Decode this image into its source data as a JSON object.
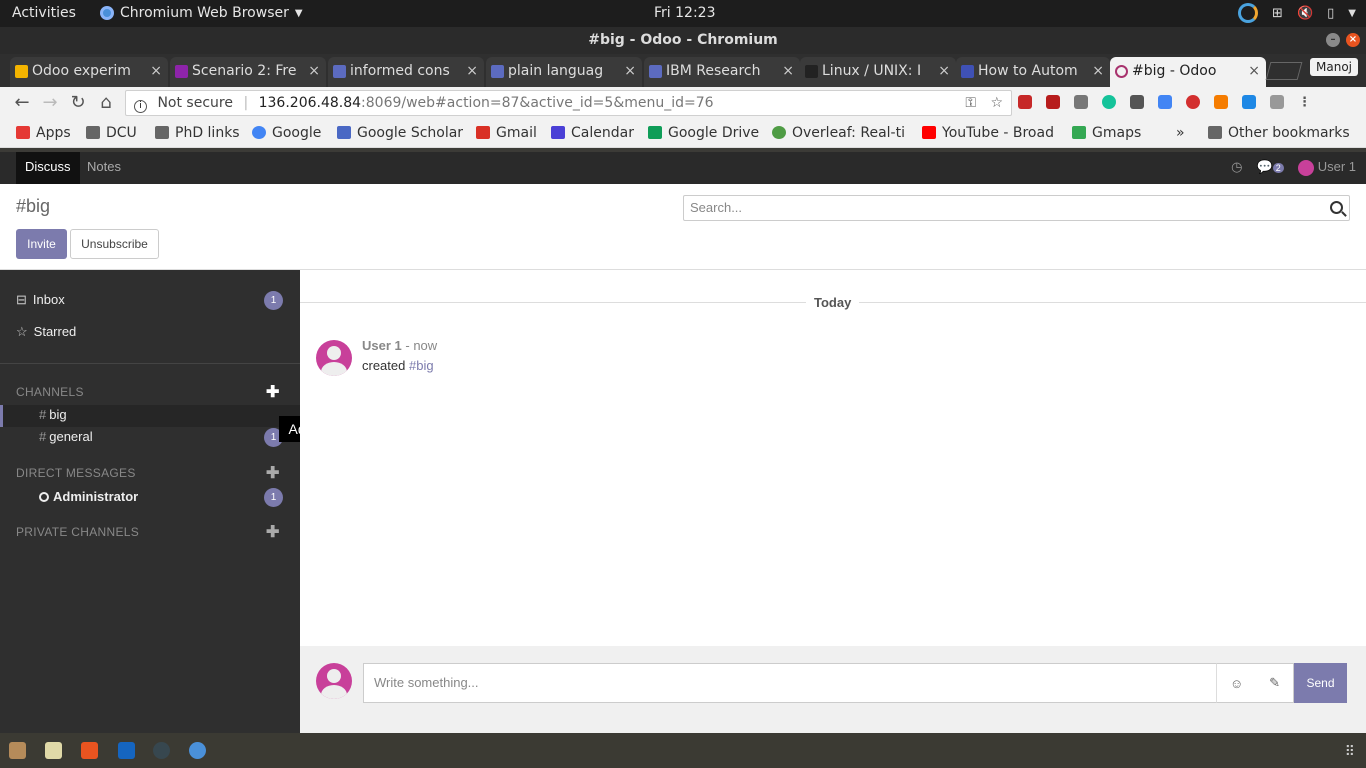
{
  "os": {
    "activities": "Activities",
    "app_name": "Chromium Web Browser",
    "clock": "Fri 12:23"
  },
  "window": {
    "title": "#big - Odoo - Chromium"
  },
  "tabs": [
    {
      "label": "Odoo experim",
      "color": "#f4b400"
    },
    {
      "label": "Scenario 2: Fre",
      "color": "#8e24aa"
    },
    {
      "label": "informed cons",
      "color": "#5c6bc0"
    },
    {
      "label": "plain languag",
      "color": "#5c6bc0"
    },
    {
      "label": "IBM Research",
      "color": "#5c6bc0"
    },
    {
      "label": "Linux / UNIX: I",
      "color": "#222222"
    },
    {
      "label": "How to Autom",
      "color": "#3f51b5"
    },
    {
      "label": "#big - Odoo",
      "color": "#a8336e"
    }
  ],
  "profile": "Manoj",
  "address": {
    "security": "Not secure",
    "host": "136.206.48.84",
    "path": ":8069/web#action=87&active_id=5&menu_id=76"
  },
  "bookmarks": [
    {
      "label": "Apps",
      "color": "#e53935"
    },
    {
      "label": "DCU",
      "color": "#666666"
    },
    {
      "label": "PhD links",
      "color": "#666666"
    },
    {
      "label": "Google",
      "color": "#4285f4"
    },
    {
      "label": "Google Scholar",
      "color": "#4a68c4"
    },
    {
      "label": "Gmail",
      "color": "#d93025"
    },
    {
      "label": "Calendar",
      "color": "#4a3fd6"
    },
    {
      "label": "Google Drive",
      "color": "#0f9d58"
    },
    {
      "label": "Overleaf: Real-ti",
      "color": "#4f9c45"
    },
    {
      "label": "YouTube - Broad",
      "color": "#ff0000"
    },
    {
      "label": "Gmaps",
      "color": "#34a853"
    }
  ],
  "bookmarks_more": "»",
  "other_bookmarks": "Other bookmarks",
  "odoo_nav": {
    "discuss": "Discuss",
    "notes": "Notes",
    "messages_count": "2",
    "user": "User 1"
  },
  "control": {
    "title": "#big",
    "invite": "Invite",
    "unsubscribe": "Unsubscribe",
    "search_placeholder": "Search..."
  },
  "sidebar": {
    "inbox": "Inbox",
    "inbox_count": "1",
    "starred": "Starred",
    "channels_header": "CHANNELS",
    "channels": [
      {
        "name": "big",
        "count": ""
      },
      {
        "name": "general",
        "count": "1"
      }
    ],
    "dm_header": "DIRECT MESSAGES",
    "dm_user": "Administrator",
    "dm_count": "1",
    "private_header": "PRIVATE CHANNELS"
  },
  "tooltip": "Add",
  "thread": {
    "separator": "Today",
    "author": "User 1",
    "time": "- now",
    "body_prefix": "created",
    "body_link": "#big"
  },
  "composer": {
    "placeholder": "Write something...",
    "send": "Send"
  },
  "colors": {
    "odoo_primary": "#7c7bad",
    "avatar": "#c8409a"
  }
}
